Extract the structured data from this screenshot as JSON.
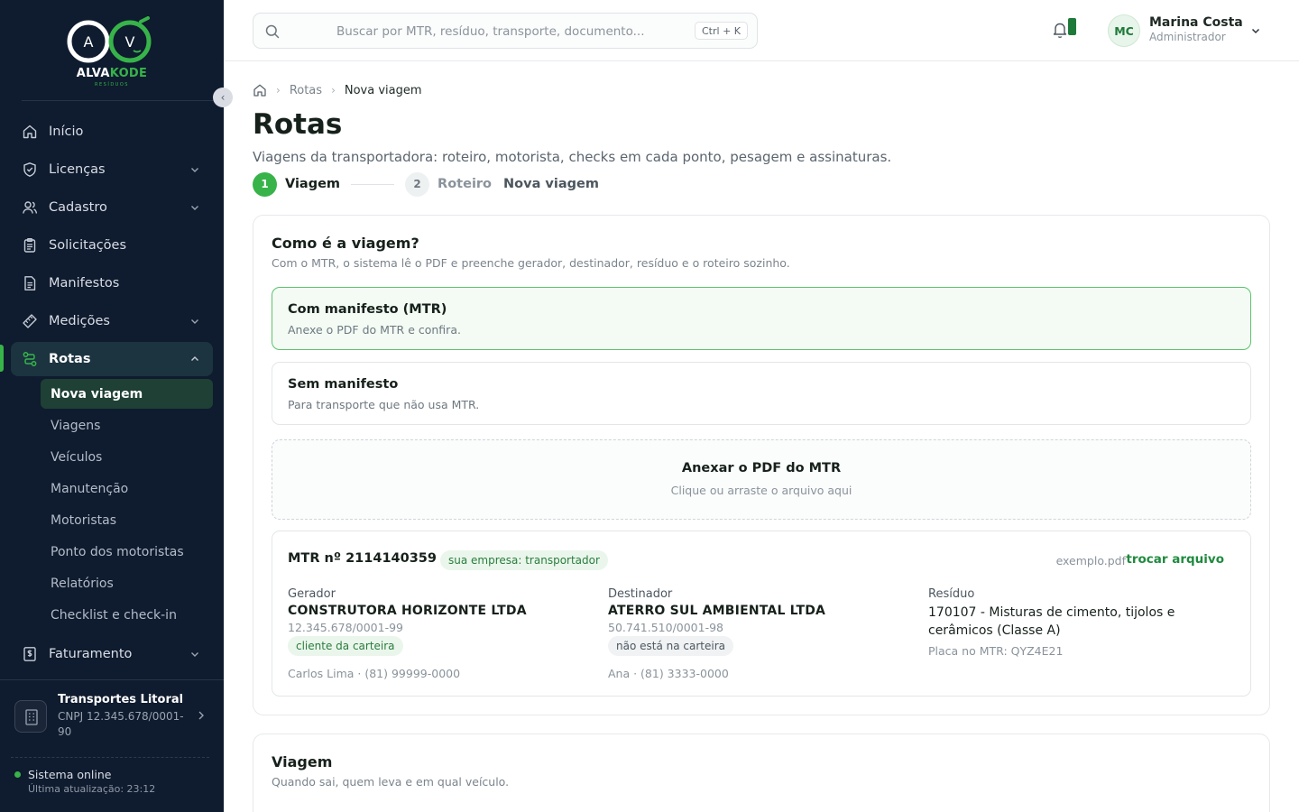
{
  "brand": {
    "name_a": "ALVA",
    "name_b": "KODE",
    "sub": "RESÍDUOS"
  },
  "colors": {
    "sidebar": "#0f1b2e",
    "accent": "#37b34a",
    "accent_dark": "#1f7a3a",
    "selected_border": "#5cc46b"
  },
  "sidebar": {
    "items": [
      {
        "label": "Início",
        "icon": "home-icon"
      },
      {
        "label": "Licenças",
        "icon": "shield-icon"
      },
      {
        "label": "Cadastro",
        "icon": "users-icon"
      },
      {
        "label": "Solicitações",
        "icon": "clipboard-icon"
      },
      {
        "label": "Manifestos",
        "icon": "document-icon"
      },
      {
        "label": "Medições",
        "icon": "ruler-icon"
      },
      {
        "label": "Rotas",
        "icon": "route-icon"
      },
      {
        "label": "Faturamento",
        "icon": "invoice-icon"
      }
    ],
    "sub_items": [
      "Nova viagem",
      "Viagens",
      "Veículos",
      "Manutenção",
      "Motoristas",
      "Ponto dos motoristas",
      "Relatórios",
      "Checklist e check-in"
    ],
    "company": {
      "name": "Transportes Litoral",
      "cnpj": "CNPJ 12.345.678/0001-90"
    },
    "status": {
      "text": "Sistema online",
      "updated": "Última atualização: 23:12"
    }
  },
  "topbar": {
    "search_placeholder": "Buscar por MTR, resíduo, transporte, documento...",
    "shortcut": "Ctrl + K",
    "user": {
      "initials": "MC",
      "name": "Marina Costa",
      "role": "Administrador"
    }
  },
  "breadcrumb": {
    "items": [
      "Rotas",
      "Nova viagem"
    ]
  },
  "page": {
    "title": "Rotas",
    "subtitle": "Viagens da transportadora: roteiro, motorista, checks em cada ponto, pesagem e assinaturas."
  },
  "steps": [
    {
      "num": "1",
      "label": "Viagem"
    },
    {
      "num": "2",
      "label": "Roteiro"
    }
  ],
  "steps_extra": "Nova viagem",
  "trip_type": {
    "title": "Como é a viagem?",
    "subtitle": "Com o MTR, o sistema lê o PDF e preenche gerador, destinador, resíduo e o roteiro sozinho.",
    "options": [
      {
        "title": "Com manifesto (MTR)",
        "desc": "Anexe o PDF do MTR e confira."
      },
      {
        "title": "Sem manifesto",
        "desc": "Para transporte que não usa MTR."
      }
    ],
    "upload": {
      "title": "Anexar o PDF do MTR",
      "hint": "Clique ou arraste o arquivo aqui"
    },
    "mtr": {
      "number": "MTR nº 2114140359",
      "role_badge": "sua empresa: transportador",
      "file_name": "exemplo.pdf",
      "swap_label": "trocar arquivo",
      "generator": {
        "label": "Gerador",
        "name": "CONSTRUTORA HORIZONTE LTDA",
        "doc": "12.345.678/0001-99",
        "badge": "cliente da carteira",
        "contact": "Carlos Lima · (81) 99999-0000"
      },
      "destination": {
        "label": "Destinador",
        "name": "ATERRO SUL AMBIENTAL LTDA",
        "doc": "50.741.510/0001-98",
        "badge": "não está na carteira",
        "contact": "Ana · (81) 3333-0000"
      },
      "waste": {
        "label": "Resíduo",
        "name": "170107 - Misturas de cimento, tijolos e cerâmicos (Classe A)",
        "plate": "Placa no MTR: QYZ4E21"
      }
    }
  },
  "trip": {
    "title": "Viagem",
    "subtitle": "Quando sai, quem leva e em qual veículo."
  }
}
